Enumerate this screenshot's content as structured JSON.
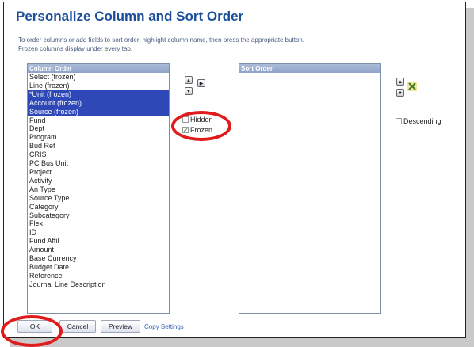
{
  "dialog": {
    "title": "Personalize Column and Sort Order",
    "instruction_line1": "To order columns or add fields to sort order, highlight column name, then press the appropriate button.",
    "instruction_line2": "Frozen columns display under every tab."
  },
  "column_order": {
    "header": "Column Order",
    "items": [
      {
        "label": "Select (frozen)",
        "selected": false
      },
      {
        "label": "Line (frozen)",
        "selected": false
      },
      {
        "label": "*Unit (frozen)",
        "selected": true
      },
      {
        "label": "Account (frozen)",
        "selected": true
      },
      {
        "label": "Source (frozen)",
        "selected": true
      },
      {
        "label": "Fund",
        "selected": false
      },
      {
        "label": "Dept",
        "selected": false
      },
      {
        "label": "Program",
        "selected": false
      },
      {
        "label": "Bud Ref",
        "selected": false
      },
      {
        "label": "CRIS",
        "selected": false
      },
      {
        "label": "PC Bus Unit",
        "selected": false
      },
      {
        "label": "Project",
        "selected": false
      },
      {
        "label": "Activity",
        "selected": false
      },
      {
        "label": "An Type",
        "selected": false
      },
      {
        "label": "Source Type",
        "selected": false
      },
      {
        "label": "Category",
        "selected": false
      },
      {
        "label": "Subcategory",
        "selected": false
      },
      {
        "label": "Flex",
        "selected": false
      },
      {
        "label": "ID",
        "selected": false
      },
      {
        "label": "Fund Affil",
        "selected": false
      },
      {
        "label": "Amount",
        "selected": false
      },
      {
        "label": "Base Currency",
        "selected": false
      },
      {
        "label": "Budget Date",
        "selected": false
      },
      {
        "label": "Reference",
        "selected": false
      },
      {
        "label": "Journal Line Description",
        "selected": false
      }
    ]
  },
  "options": {
    "hidden_label": "Hidden",
    "hidden_checked": false,
    "frozen_label": "Frozen",
    "frozen_checked": true
  },
  "sort_order": {
    "header": "Sort Order",
    "descending_label": "Descending",
    "descending_checked": false
  },
  "buttons": {
    "ok": "OK",
    "cancel": "Cancel",
    "preview": "Preview",
    "copy_settings": "Copy Settings"
  },
  "colors": {
    "title": "#1c4f9a",
    "selection": "#2e48b7",
    "annotation_ring": "#e01b1b"
  },
  "icons": {
    "move_up": "arrow-up-icon",
    "move_down": "arrow-down-icon",
    "add_to_sort": "arrow-right-icon",
    "remove_from_sort": "x-icon"
  }
}
